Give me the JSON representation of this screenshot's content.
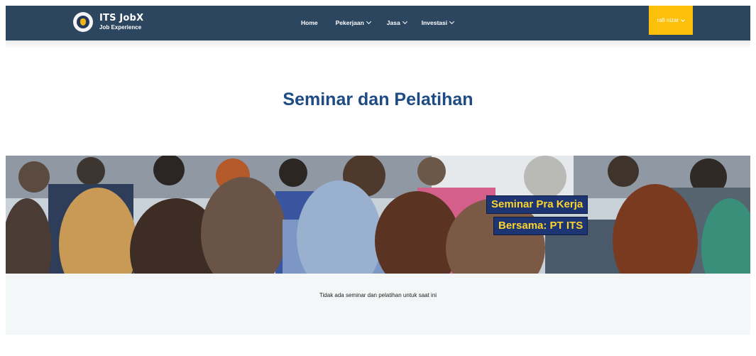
{
  "brand": {
    "title": "ITS JobX",
    "subtitle": "Job Experience"
  },
  "nav": {
    "home": "Home",
    "pekerjaan": "Pekerjaan",
    "jasa": "Jasa",
    "investasi": "Investasi"
  },
  "user": {
    "name": "rafi nizar"
  },
  "page": {
    "title": "Seminar dan Pelatihan"
  },
  "banner": {
    "line1": "Seminar Pra Kerja",
    "line2": "Bersama: PT ITS"
  },
  "empty": {
    "message": "Tidak ada seminar dan pelatihan untuk saat ini"
  },
  "colors": {
    "navbar": "#2c4660",
    "accent": "#fcbf0c",
    "title": "#1e4b84",
    "tag_bg": "#1d3572",
    "tag_text": "#fcd42c"
  }
}
